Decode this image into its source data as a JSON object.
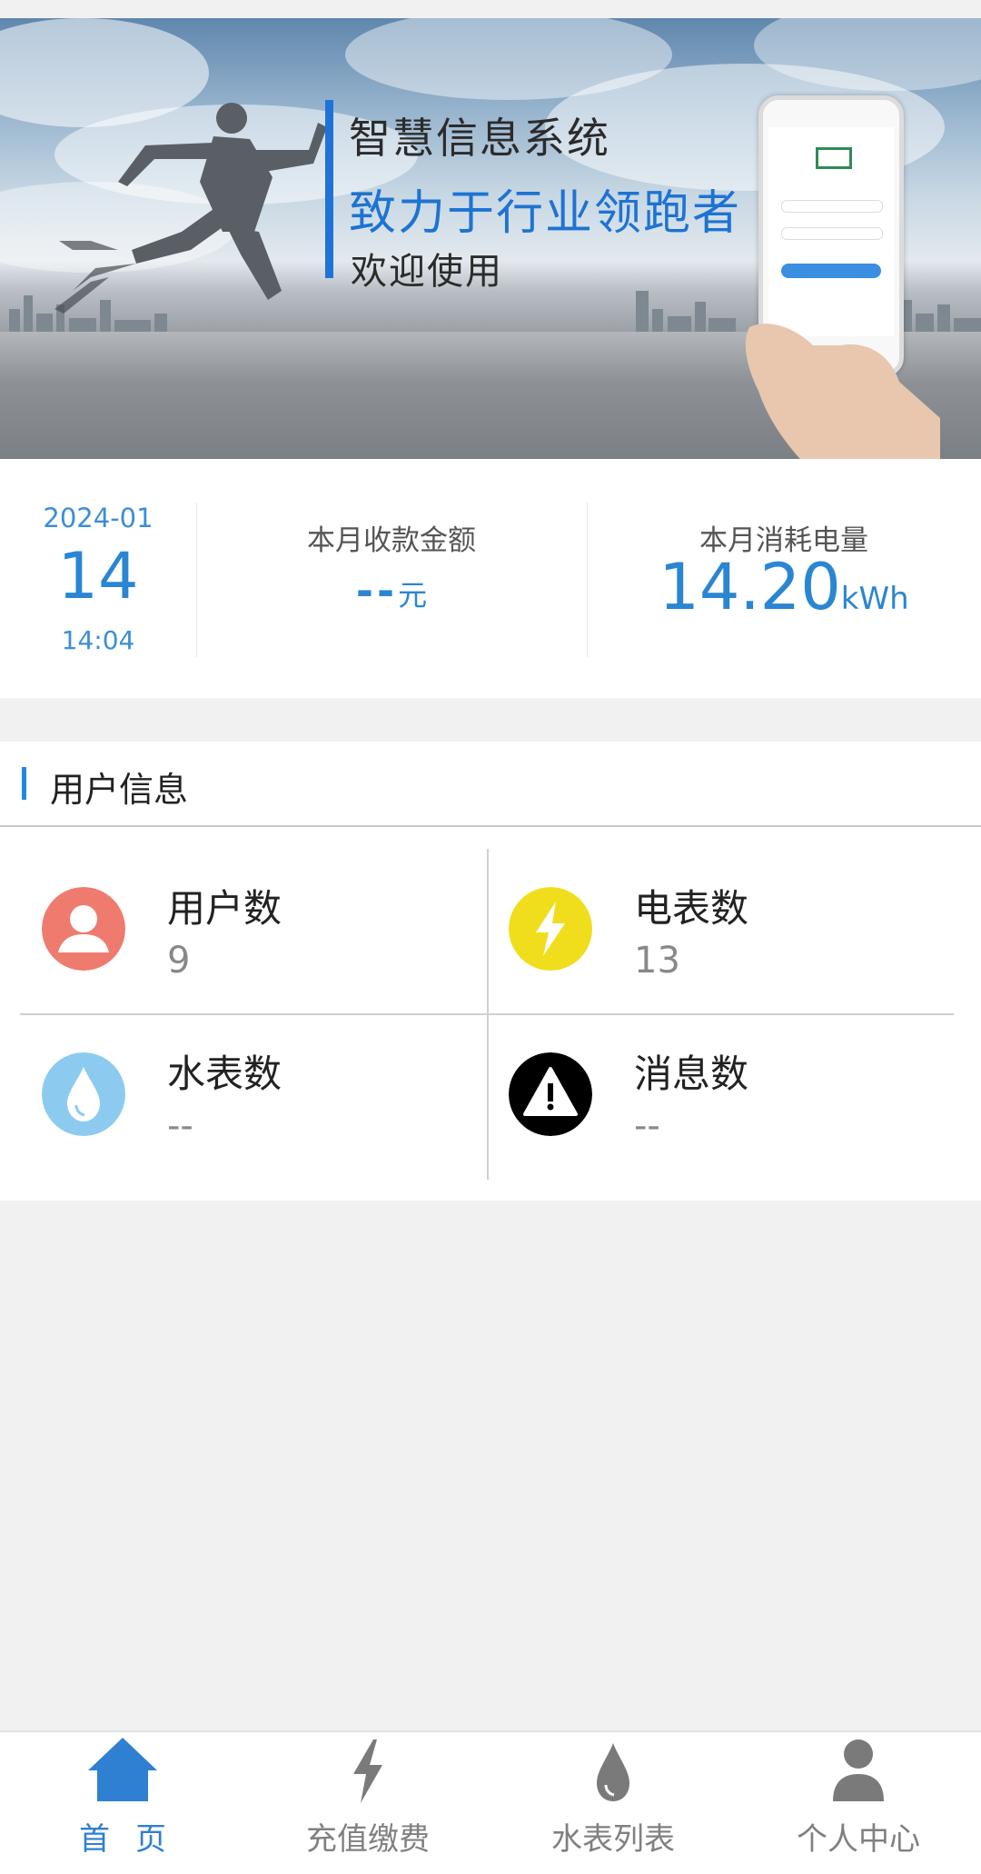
{
  "banner": {
    "line1": "智慧信息系统",
    "line2": "致力于行业领跑者",
    "line3": "欢迎使用"
  },
  "stats": {
    "date_year_month": "2024-01",
    "date_day": "14",
    "time": "14:04",
    "collection_label": "本月收款金额",
    "collection_value": "--",
    "collection_unit": "元",
    "power_label": "本月消耗电量",
    "power_value": "14.20",
    "power_unit": "kWh"
  },
  "user_info": {
    "title": "用户信息",
    "cells": [
      {
        "label": "用户数",
        "value": "9",
        "icon": "user-icon",
        "color": "#ef7b6f"
      },
      {
        "label": "电表数",
        "value": "13",
        "icon": "lightning-icon",
        "color": "#f0de1d"
      },
      {
        "label": "水表数",
        "value": "--",
        "icon": "water-drop-icon",
        "color": "#8ccbef"
      },
      {
        "label": "消息数",
        "value": "--",
        "icon": "warning-icon",
        "color": "#000000"
      }
    ]
  },
  "tabbar": {
    "tabs": [
      {
        "label": "首页",
        "icon": "home-icon",
        "active": true
      },
      {
        "label": "充值缴费",
        "icon": "lightning-icon",
        "active": false
      },
      {
        "label": "水表列表",
        "icon": "water-drop-icon",
        "active": false
      },
      {
        "label": "个人中心",
        "icon": "person-icon",
        "active": false
      }
    ]
  },
  "colors": {
    "accent": "#2a86d2",
    "tab_active": "#2f7fd2",
    "tab_inactive": "#808080"
  }
}
